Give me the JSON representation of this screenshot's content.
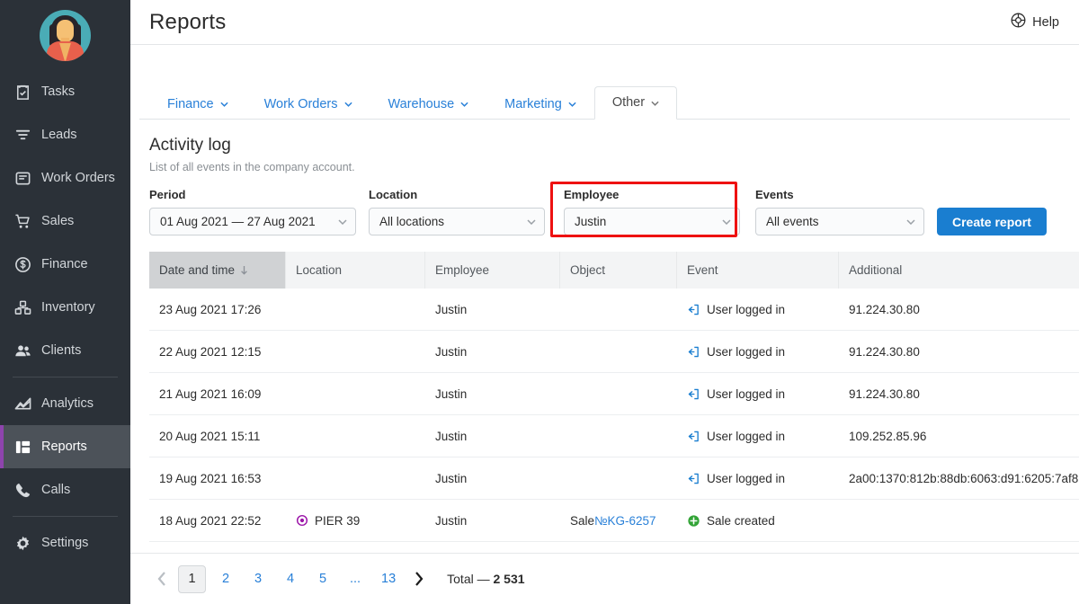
{
  "sidebar": {
    "avatar_alt": "user-avatar",
    "items": [
      {
        "label": "Tasks",
        "icon": "clipboard-check-icon",
        "active": false,
        "divider_before": false
      },
      {
        "label": "Leads",
        "icon": "funnel-icon",
        "active": false,
        "divider_before": false
      },
      {
        "label": "Work Orders",
        "icon": "inbox-icon",
        "active": false,
        "divider_before": false
      },
      {
        "label": "Sales",
        "icon": "shopping-cart-icon",
        "active": false,
        "divider_before": false
      },
      {
        "label": "Finance",
        "icon": "dollar-circle-icon",
        "active": false,
        "divider_before": false
      },
      {
        "label": "Inventory",
        "icon": "boxes-icon",
        "active": false,
        "divider_before": false
      },
      {
        "label": "Clients",
        "icon": "people-icon",
        "active": false,
        "divider_before": false
      },
      {
        "label": "Analytics",
        "icon": "chart-area-icon",
        "active": false,
        "divider_before": true
      },
      {
        "label": "Reports",
        "icon": "layout-grid-icon",
        "active": true,
        "divider_before": false
      },
      {
        "label": "Calls",
        "icon": "phone-icon",
        "active": false,
        "divider_before": false
      },
      {
        "label": "Settings",
        "icon": "gear-icon",
        "active": false,
        "divider_before": true
      }
    ],
    "active_accent": "#8e44ad",
    "background": "#2b3138"
  },
  "header": {
    "title": "Reports",
    "help_label": "Help",
    "help_icon": "lifebuoy-icon"
  },
  "tabs": [
    {
      "label": "Finance",
      "active": false
    },
    {
      "label": "Work Orders",
      "active": false
    },
    {
      "label": "Warehouse",
      "active": false
    },
    {
      "label": "Marketing",
      "active": false
    },
    {
      "label": "Other",
      "active": true
    }
  ],
  "section": {
    "title": "Activity log",
    "subtitle": "List of all events in the company account."
  },
  "filters": {
    "period": {
      "label": "Period",
      "value": "01 Aug 2021 — 27 Aug 2021"
    },
    "location": {
      "label": "Location",
      "value": "All locations"
    },
    "employee": {
      "label": "Employee",
      "value": "Justin",
      "highlighted": true
    },
    "events": {
      "label": "Events",
      "value": "All events"
    },
    "create_button": "Create report",
    "highlight_color": "#ee1111",
    "button_color": "#1a7ed0"
  },
  "table": {
    "columns": [
      {
        "label": "Date and time",
        "sorted": true,
        "sort_dir": "desc"
      },
      {
        "label": "Location",
        "sorted": false
      },
      {
        "label": "Employee",
        "sorted": false
      },
      {
        "label": "Object",
        "sorted": false
      },
      {
        "label": "Event",
        "sorted": false
      },
      {
        "label": "Additional",
        "sorted": false
      }
    ],
    "rows": [
      {
        "datetime": "23 Aug 2021 17:26",
        "location": "",
        "location_icon": "",
        "employee": "Justin",
        "object_prefix": "",
        "object_link": "",
        "event": "User logged in",
        "event_icon": "login-icon",
        "additional": "91.224.30.80"
      },
      {
        "datetime": "22 Aug 2021 12:15",
        "location": "",
        "location_icon": "",
        "employee": "Justin",
        "object_prefix": "",
        "object_link": "",
        "event": "User logged in",
        "event_icon": "login-icon",
        "additional": "91.224.30.80"
      },
      {
        "datetime": "21 Aug 2021 16:09",
        "location": "",
        "location_icon": "",
        "employee": "Justin",
        "object_prefix": "",
        "object_link": "",
        "event": "User logged in",
        "event_icon": "login-icon",
        "additional": "91.224.30.80"
      },
      {
        "datetime": "20 Aug 2021 15:11",
        "location": "",
        "location_icon": "",
        "employee": "Justin",
        "object_prefix": "",
        "object_link": "",
        "event": "User logged in",
        "event_icon": "login-icon",
        "additional": "109.252.85.96"
      },
      {
        "datetime": "19 Aug 2021 16:53",
        "location": "",
        "location_icon": "",
        "employee": "Justin",
        "object_prefix": "",
        "object_link": "",
        "event": "User logged in",
        "event_icon": "login-icon",
        "additional": "2a00:1370:812b:88db:6063:d91:6205:7af8"
      },
      {
        "datetime": "18 Aug 2021 22:52",
        "location": "PIER 39",
        "location_icon": "target-pin-icon",
        "employee": "Justin",
        "object_prefix": "Sale ",
        "object_link": "№KG-6257",
        "event": "Sale created",
        "event_icon": "plus-circle-icon",
        "additional": ""
      }
    ]
  },
  "pagination": {
    "prev_icon": "chevron-left-icon",
    "next_icon": "chevron-right-icon",
    "pages": [
      "1",
      "2",
      "3",
      "4",
      "5",
      "...",
      "13"
    ],
    "active_page": "1",
    "total_label": "Total — ",
    "total_value": "2 531"
  }
}
